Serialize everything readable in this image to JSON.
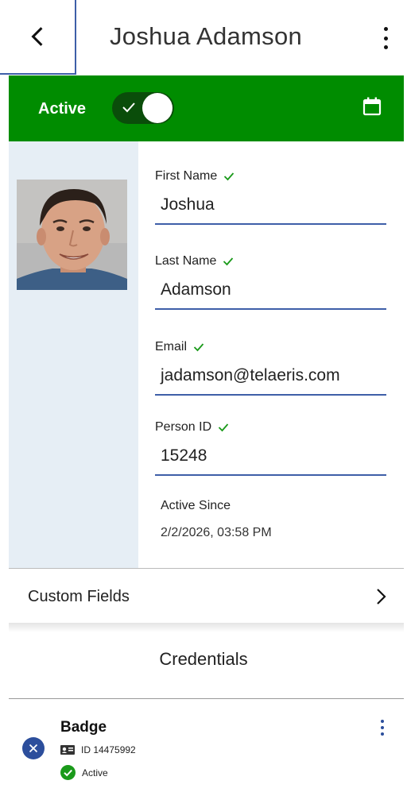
{
  "header": {
    "title": "Joshua Adamson",
    "back_icon": "chevron-left-icon",
    "menu_icon": "more-vertical-icon"
  },
  "status": {
    "label": "Active",
    "toggle_on": true,
    "calendar_icon": "calendar-icon",
    "color": "#008c00"
  },
  "person": {
    "photo_alt": "Portrait of Joshua Adamson",
    "fields": {
      "first_name": {
        "label": "First Name",
        "value": "Joshua",
        "verified": true
      },
      "last_name": {
        "label": "Last Name",
        "value": "Adamson",
        "verified": true
      },
      "email": {
        "label": "Email",
        "value": "jadamson@telaeris.com",
        "verified": true
      },
      "person_id": {
        "label": "Person ID",
        "value": "15248",
        "verified": true
      }
    },
    "active_since": {
      "label": "Active Since",
      "value": "2/2/2026, 03:58 PM"
    }
  },
  "custom_fields": {
    "label": "Custom Fields",
    "icon": "chevron-right-icon"
  },
  "credentials": {
    "title": "Credentials",
    "items": [
      {
        "name": "Badge",
        "id_text": "ID 14475992",
        "status": "Active",
        "status_color": "#1a9a1a",
        "accent": "#2c4e9c"
      }
    ]
  }
}
